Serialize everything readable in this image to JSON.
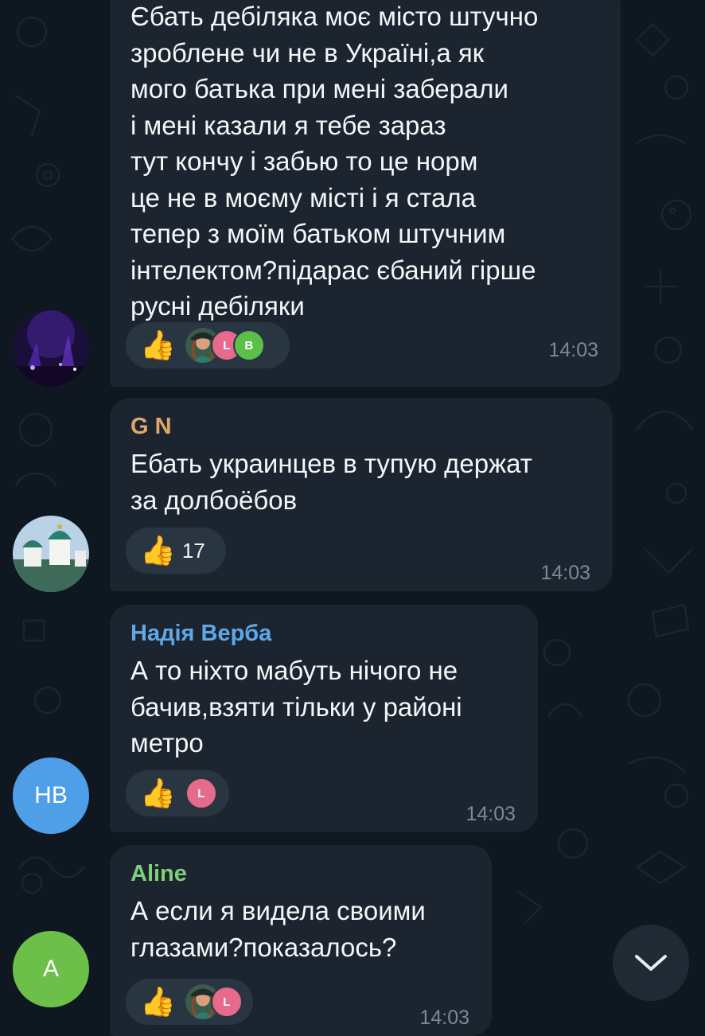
{
  "messages": [
    {
      "text": "Єбать дебіляка моє місто штучно\nзроблене чи не в Україні,а як\nмого батька при мені заберали\nі мені казали я тебе зараз\nтут кончу і забью то це норм\nце не в моєму місті і я стала\nтепер з моїм батьком штучним\nінтелектом?підарас єбаний гірше\nрусні дебіляки",
      "time": "14:03",
      "reaction": {
        "emoji": "👍",
        "users": [
          "L",
          "B"
        ]
      }
    },
    {
      "sender": "G N",
      "sender_color": "#e0a66a",
      "text": "Ебать украинцев в тупую держат\nза долбоёбов",
      "time": "14:03",
      "reaction": {
        "emoji": "👍",
        "count": "17"
      }
    },
    {
      "sender": "Надія Верба",
      "sender_color": "#5fa8e8",
      "avatar_initials": "НВ",
      "text": "А то ніхто мабуть нічого не\nбачив,взяти тільки у районі\nметро",
      "time": "14:03",
      "reaction": {
        "emoji": "👍",
        "users": [
          "L"
        ]
      }
    },
    {
      "sender": "Aline",
      "sender_color": "#7fd07a",
      "avatar_initials": "A",
      "text": "А если я видела своими\nглазами?показалось?",
      "time": "14:03",
      "reaction": {
        "emoji": "👍",
        "users": [
          "L"
        ]
      }
    }
  ],
  "colors": {
    "background": "#0f1720",
    "bubble": "#1c252f",
    "reaction_pill": "#2a3542",
    "avatar_nv": "#4f9ee8",
    "avatar_a": "#6cc04a",
    "mini_l": "#e56a8c",
    "mini_b": "#5cbf4a"
  },
  "icons": {
    "scroll_down": "chevron-down-icon",
    "reaction": "thumbs-up-icon"
  }
}
